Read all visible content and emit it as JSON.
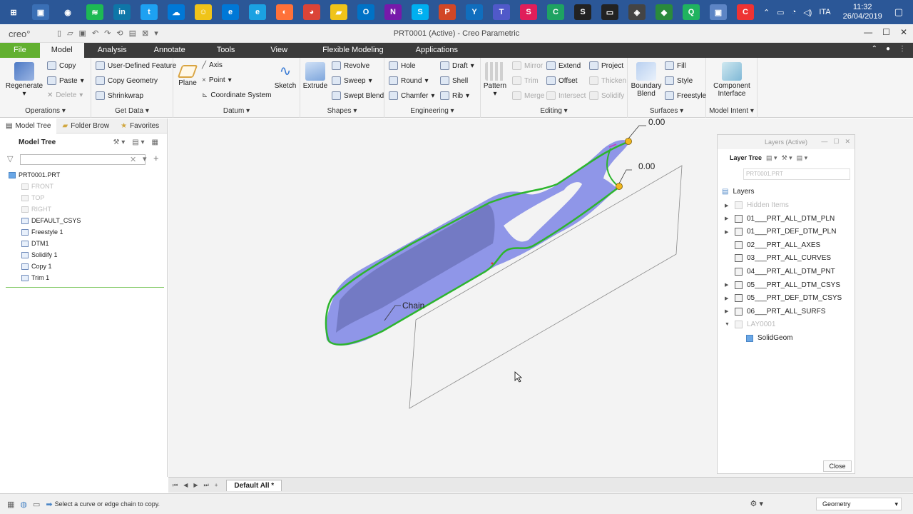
{
  "taskbar": {
    "icons": [
      "windows-start",
      "explore",
      "webcam",
      "spotify",
      "linkedin",
      "twitter",
      "cloud",
      "smile",
      "edge",
      "ie",
      "firefox",
      "chrome",
      "explorer",
      "outlook",
      "onenote",
      "skype",
      "powerpoint",
      "yammer",
      "teams",
      "slack-ish",
      "camtasia",
      "terminal",
      "monitor",
      "game",
      "layers",
      "search-green",
      "creo-active",
      "capture"
    ],
    "lang": "ITA",
    "time": "11:32",
    "date": "26/04/2019"
  },
  "titlebar": {
    "logo": "creo°",
    "title": "PRT0001 (Active) - Creo Parametric"
  },
  "tabs": [
    "File",
    "Model",
    "Analysis",
    "Annotate",
    "Tools",
    "View",
    "Flexible Modeling",
    "Applications"
  ],
  "active_tab": "Model",
  "ribbon": {
    "operations": {
      "label": "Operations ▾",
      "regenerate": "Regenerate",
      "copy": "Copy",
      "paste": "Paste",
      "delete": "Delete"
    },
    "getdata": {
      "label": "Get Data ▾",
      "udf": "User-Defined Feature",
      "copygeom": "Copy Geometry",
      "shrinkwrap": "Shrinkwrap"
    },
    "datum": {
      "label": "Datum ▾",
      "plane": "Plane",
      "axis": "Axis",
      "point": "Point",
      "csys": "Coordinate System",
      "sketch": "Sketch"
    },
    "shapes": {
      "label": "Shapes ▾",
      "extrude": "Extrude",
      "revolve": "Revolve",
      "sweep": "Sweep",
      "sweptblend": "Swept Blend"
    },
    "engineering": {
      "label": "Engineering ▾",
      "hole": "Hole",
      "round": "Round",
      "chamfer": "Chamfer",
      "draft": "Draft",
      "shell": "Shell",
      "rib": "Rib"
    },
    "editing": {
      "label": "Editing ▾",
      "pattern": "Pattern",
      "mirror": "Mirror",
      "trim": "Trim",
      "merge": "Merge",
      "extend": "Extend",
      "offset": "Offset",
      "intersect": "Intersect",
      "project": "Project",
      "thicken": "Thicken",
      "solidify": "Solidify"
    },
    "surfaces": {
      "label": "Surfaces ▾",
      "boundary": "Boundary Blend",
      "fill": "Fill",
      "style": "Style",
      "freestyle": "Freestyle"
    },
    "modelintent": {
      "label": "Model Intent ▾",
      "component": "Component Interface"
    }
  },
  "leftpanel": {
    "tabs": [
      "Model Tree",
      "Folder Brow",
      "Favorites"
    ],
    "header": "Model Tree",
    "filter_placeholder": "",
    "root": "PRT0001.PRT",
    "items": [
      {
        "label": "FRONT",
        "dim": true
      },
      {
        "label": "TOP",
        "dim": true
      },
      {
        "label": "RIGHT",
        "dim": true
      },
      {
        "label": "DEFAULT_CSYS",
        "dim": false
      },
      {
        "label": "Freestyle 1",
        "dim": false
      },
      {
        "label": "DTM1",
        "dim": false
      },
      {
        "label": "Solidify 1",
        "dim": false
      },
      {
        "label": "Copy 1",
        "dim": false
      },
      {
        "label": "Trim 1",
        "dim": false
      }
    ]
  },
  "graphics": {
    "dim_label_1": "0.00",
    "dim_label_2": "0.00",
    "chain_label": "Chain",
    "colors": {
      "surface": "#8f96e8",
      "edge": "#2db52d",
      "handle": "#f2b81e"
    }
  },
  "layers": {
    "title": "Layers (Active)",
    "tool_label": "Layer Tree",
    "model_select": "PRT0001.PRT",
    "root": "Layers",
    "items": [
      {
        "label": "Hidden Items",
        "expander": "▶",
        "dim": true
      },
      {
        "label": "01___PRT_ALL_DTM_PLN",
        "expander": "▶",
        "dim": false
      },
      {
        "label": "01___PRT_DEF_DTM_PLN",
        "expander": "▶",
        "dim": false
      },
      {
        "label": "02___PRT_ALL_AXES",
        "expander": "",
        "dim": false
      },
      {
        "label": "03___PRT_ALL_CURVES",
        "expander": "",
        "dim": false
      },
      {
        "label": "04___PRT_ALL_DTM_PNT",
        "expander": "",
        "dim": false
      },
      {
        "label": "05___PRT_ALL_DTM_CSYS",
        "expander": "▶",
        "dim": false
      },
      {
        "label": "05___PRT_DEF_DTM_CSYS",
        "expander": "▶",
        "dim": false
      },
      {
        "label": "06___PRT_ALL_SURFS",
        "expander": "▶",
        "dim": false
      },
      {
        "label": "LAY0001",
        "expander": "▼",
        "dim": true
      }
    ],
    "sub_item": "SolidGeom",
    "close": "Close"
  },
  "viewbar": {
    "tab": "Default All *"
  },
  "status": {
    "message": "Select a curve or edge chain to copy.",
    "filter": "Geometry"
  }
}
